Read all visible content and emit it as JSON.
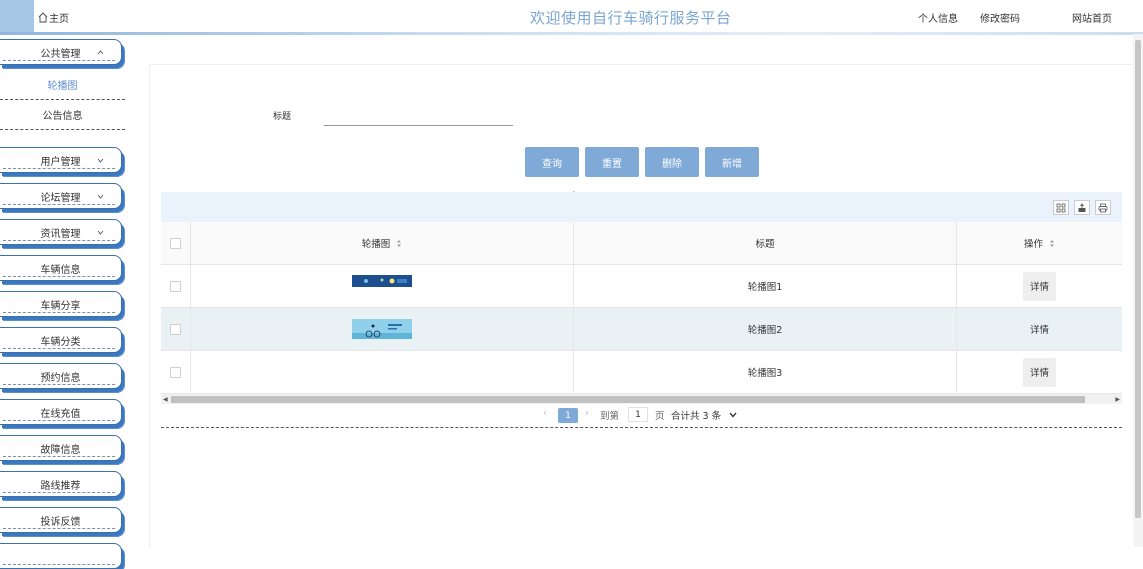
{
  "header": {
    "home_label": "主页",
    "title": "欢迎使用自行车骑行服务平台",
    "links": [
      "个人信息",
      "修改密码",
      "网站首页"
    ]
  },
  "sidebar": {
    "public_mgmt": "公共管理",
    "sub_items": [
      {
        "label": "轮播图",
        "active": true
      },
      {
        "label": "公告信息",
        "active": false
      }
    ],
    "menus": [
      {
        "label": "用户管理",
        "has_chevron": true
      },
      {
        "label": "论坛管理",
        "has_chevron": true
      },
      {
        "label": "资讯管理",
        "has_chevron": true
      },
      {
        "label": "车辆信息",
        "has_chevron": false
      },
      {
        "label": "车辆分享",
        "has_chevron": false
      },
      {
        "label": "车辆分类",
        "has_chevron": false
      },
      {
        "label": "预约信息",
        "has_chevron": false
      },
      {
        "label": "在线充值",
        "has_chevron": false
      },
      {
        "label": "故障信息",
        "has_chevron": false
      },
      {
        "label": "路线推荐",
        "has_chevron": false
      },
      {
        "label": "投诉反馈",
        "has_chevron": false
      }
    ]
  },
  "search": {
    "label": "标题",
    "value": ""
  },
  "actions": {
    "query": "查询",
    "reset": "重置",
    "delete": "删除",
    "add": "新增"
  },
  "table": {
    "columns": [
      "轮播图",
      "标题",
      "操作"
    ],
    "rows": [
      {
        "title": "轮播图1",
        "action": "详情"
      },
      {
        "title": "轮播图2",
        "action": "详情"
      },
      {
        "title": "轮播图3",
        "action": "详情"
      }
    ]
  },
  "pager": {
    "current": "1",
    "goto_label": "到第",
    "goto_value": "1",
    "page_label": "页",
    "total": "合计共 3 条"
  },
  "colors": {
    "accent": "#7fa9d6",
    "title": "#7ba6d2",
    "toolbar": "#eaf2fb"
  }
}
